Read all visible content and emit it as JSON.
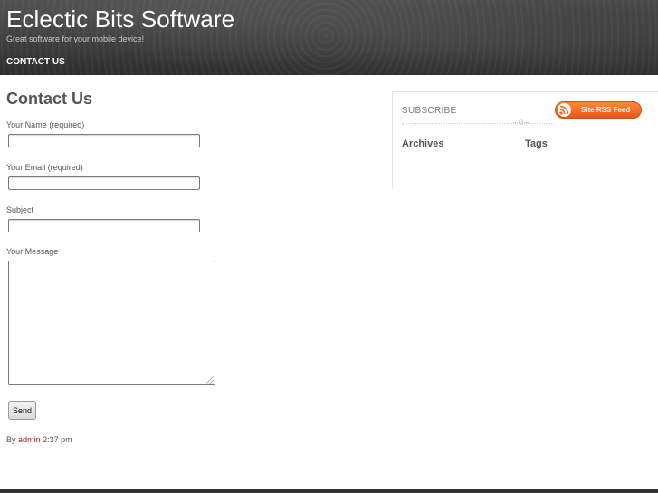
{
  "header": {
    "site_title": "Eclectic Bits Software",
    "tagline": "Great software for your mobile device!",
    "nav": {
      "contact_label": "CONTACT US"
    }
  },
  "main": {
    "page_title": "Contact Us",
    "form": {
      "name_label": "Your Name (required)",
      "name_value": "",
      "email_label": "Your Email (required)",
      "email_value": "",
      "subject_label": "Subject",
      "subject_value": "",
      "message_label": "Your Message",
      "message_value": "",
      "send_label": "Send"
    },
    "byline": {
      "prefix": "By",
      "author": "admin",
      "time": "2:37 pm"
    }
  },
  "sidebar": {
    "subscribe_title": "SUBSCRIBE",
    "rss_label": "Site RSS Feed",
    "ornament": "~ଓ~",
    "archives_title": "Archives",
    "tags_title": "Tags"
  },
  "colors": {
    "header_bg": "#3a3a3a",
    "link_red": "#b01c1c",
    "rss_orange": "#f06a22"
  }
}
